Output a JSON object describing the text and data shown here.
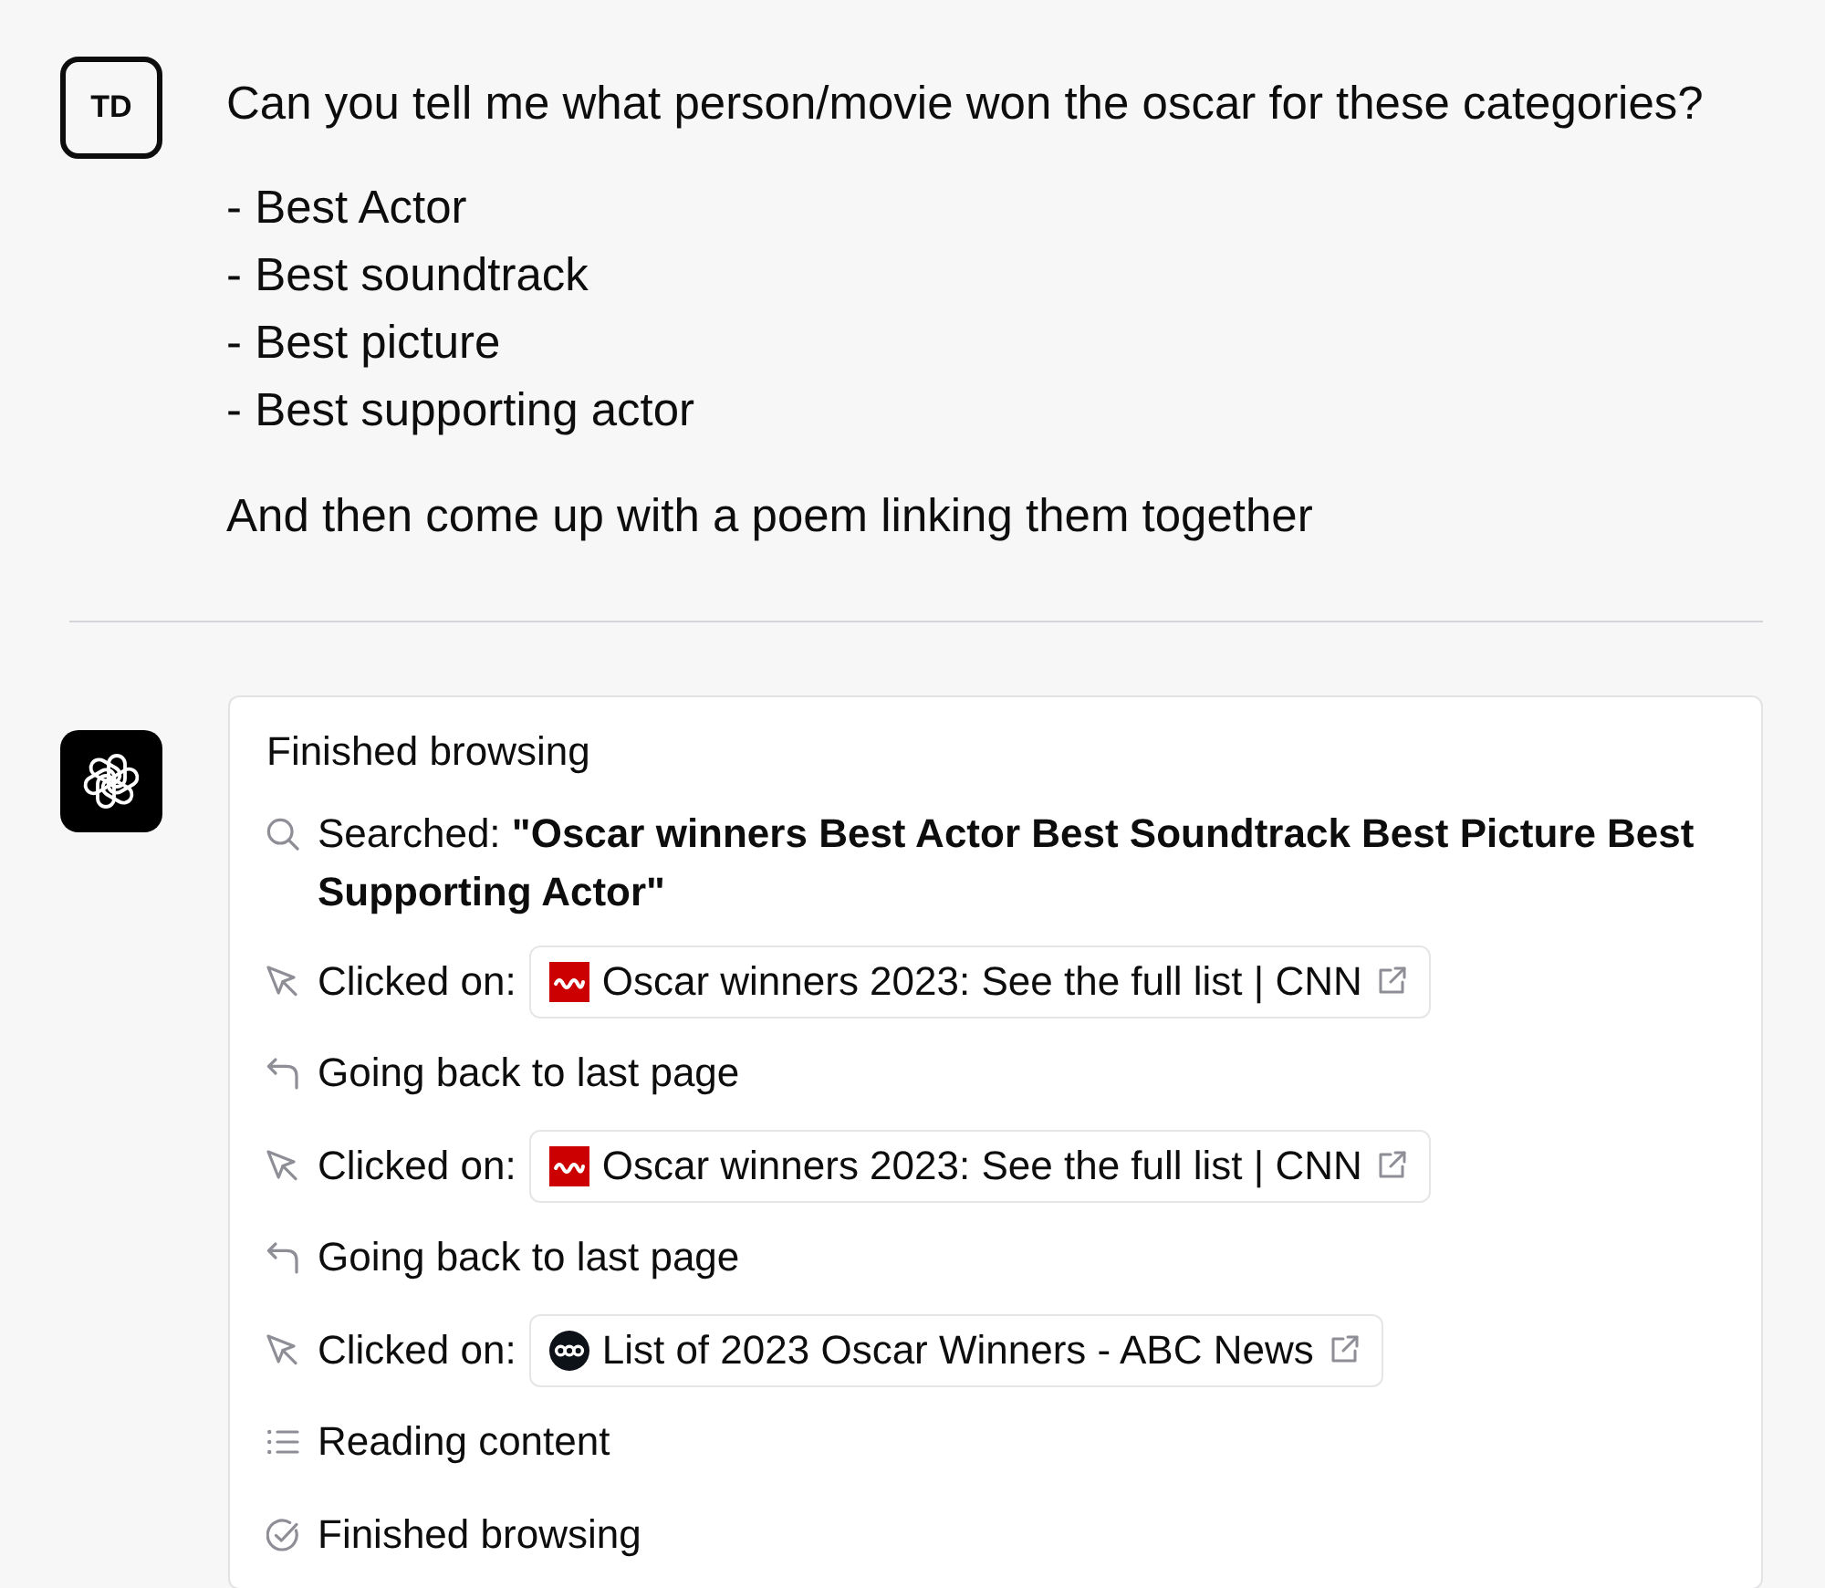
{
  "user_message": {
    "avatar": "TD",
    "question": "Can you tell me what person/movie won the oscar for these categories?",
    "items": [
      "- Best Actor",
      "- Best soundtrack",
      "- Best picture",
      "- Best supporting actor"
    ],
    "closing": "And then come up with a poem linking them together"
  },
  "assistant_message": {
    "browsing": {
      "title": "Finished browsing",
      "steps": [
        {
          "kind": "search",
          "text": "Searched: **\"Oscar winners Best Actor Best Soundtrack Best Picture Best Supporting Actor\"**"
        },
        {
          "kind": "click",
          "text": "Clicked on:",
          "link": {
            "kind": "square",
            "title": "Oscar winners 2023: See the full list | CNN"
          }
        },
        {
          "kind": "back",
          "text": "Going back to last page"
        },
        {
          "kind": "click",
          "text": "Clicked on:",
          "link": {
            "kind": "square",
            "title": "Oscar winners 2023: See the full list | CNN"
          }
        },
        {
          "kind": "back",
          "text": "Going back to last page"
        },
        {
          "kind": "click",
          "text": "Clicked on:",
          "link": {
            "kind": "round",
            "title": "List of 2023 Oscar Winners - ABC News"
          }
        },
        {
          "kind": "reading",
          "text": "Reading content"
        },
        {
          "kind": "done",
          "text": "Finished browsing"
        }
      ]
    }
  }
}
